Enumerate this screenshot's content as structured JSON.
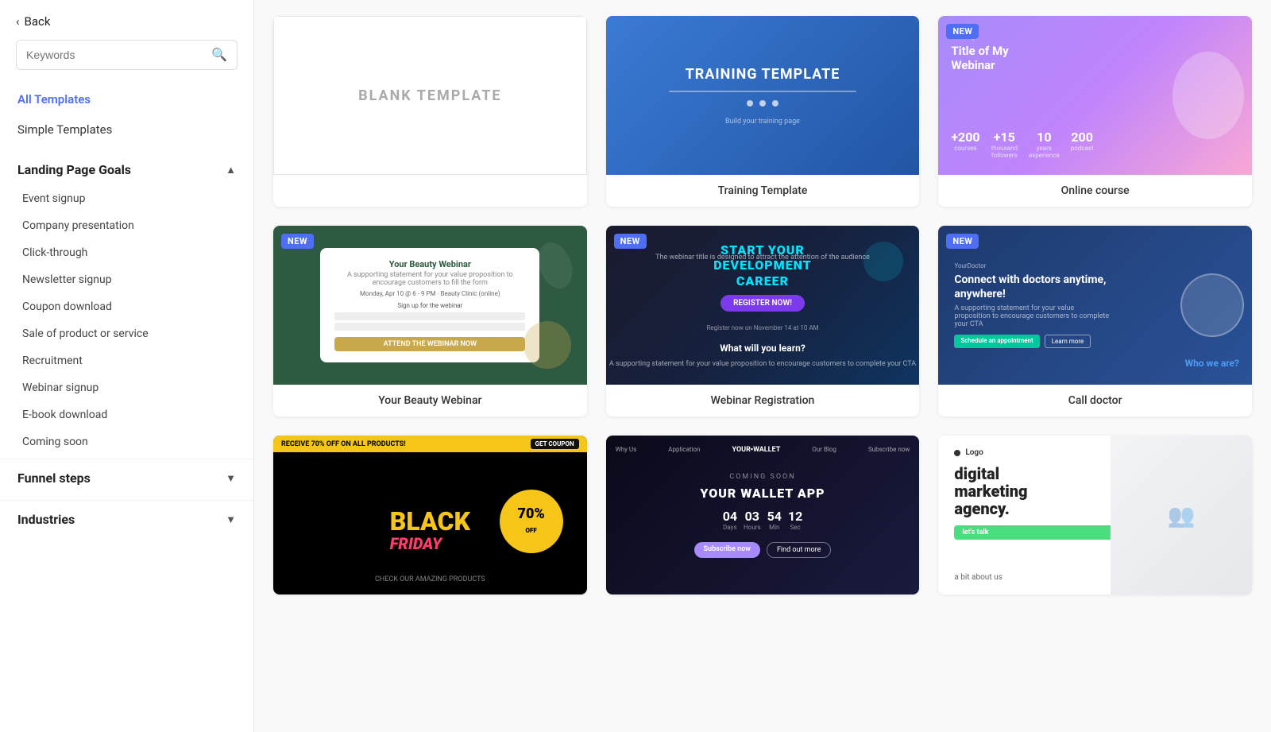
{
  "sidebar": {
    "back_label": "Back",
    "search_placeholder": "Keywords",
    "nav": [
      {
        "id": "all-templates",
        "label": "All Templates",
        "active": true
      },
      {
        "id": "simple-templates",
        "label": "Simple Templates",
        "active": false
      }
    ],
    "landing_page_goals": {
      "title": "Landing Page Goals",
      "expanded": true,
      "items": [
        "Event signup",
        "Company presentation",
        "Click-through",
        "Newsletter signup",
        "Coupon download",
        "Sale of product or service",
        "Recruitment",
        "Webinar signup",
        "E-book download",
        "Coming soon"
      ]
    },
    "funnel_steps": {
      "title": "Funnel steps",
      "expanded": false
    },
    "industries": {
      "title": "Industries",
      "expanded": false
    }
  },
  "templates": [
    {
      "id": "blank",
      "label": "BLANK TEMPLATE",
      "type": "blank",
      "isNew": false
    },
    {
      "id": "training",
      "label": "Training Template",
      "type": "training",
      "isNew": false
    },
    {
      "id": "online-course",
      "label": "Online course",
      "type": "online",
      "isNew": true
    },
    {
      "id": "beauty-webinar",
      "label": "Your Beauty Webinar",
      "type": "beauty",
      "isNew": true
    },
    {
      "id": "webinar-reg",
      "label": "Webinar Registration",
      "type": "webinar",
      "isNew": true
    },
    {
      "id": "call-doctor",
      "label": "Call doctor",
      "type": "doctor",
      "isNew": true
    },
    {
      "id": "black-friday",
      "label": "",
      "type": "blackfriday",
      "isNew": false
    },
    {
      "id": "wallet-app",
      "label": "",
      "type": "wallet",
      "isNew": false
    },
    {
      "id": "digital-marketing",
      "label": "",
      "type": "digital",
      "isNew": false
    }
  ],
  "badges": {
    "new": "NEW"
  }
}
